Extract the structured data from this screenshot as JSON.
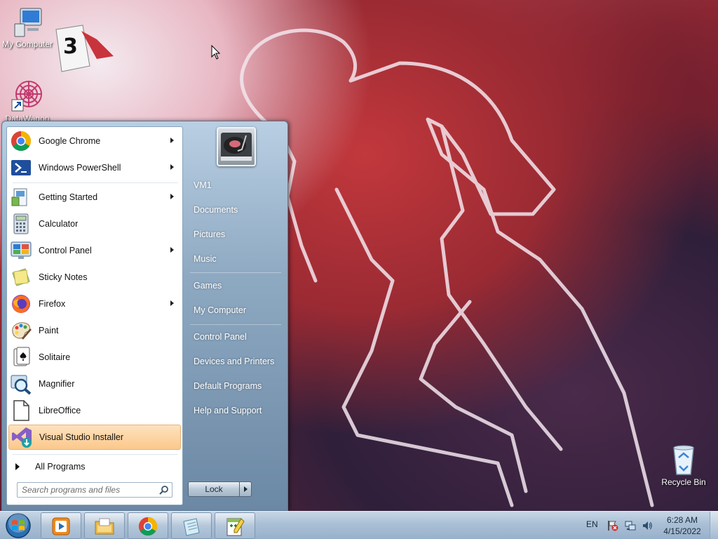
{
  "desktop": {
    "icons": [
      {
        "label": "My Computer"
      },
      {
        "label": "DataWagon"
      },
      {
        "label": "Recycle Bin"
      }
    ]
  },
  "start_menu": {
    "programs": [
      {
        "label": "Google Chrome",
        "icon": "chrome-icon",
        "submenu": true
      },
      {
        "label": "Windows PowerShell",
        "icon": "powershell-icon",
        "submenu": true
      },
      {
        "label": "Getting Started",
        "icon": "getting-started-icon",
        "submenu": true
      },
      {
        "label": "Calculator",
        "icon": "calculator-icon",
        "submenu": false
      },
      {
        "label": "Control Panel",
        "icon": "control-panel-icon",
        "submenu": true
      },
      {
        "label": "Sticky Notes",
        "icon": "sticky-notes-icon",
        "submenu": false
      },
      {
        "label": "Firefox",
        "icon": "firefox-icon",
        "submenu": true
      },
      {
        "label": "Paint",
        "icon": "paint-icon",
        "submenu": false
      },
      {
        "label": "Solitaire",
        "icon": "solitaire-icon",
        "submenu": false
      },
      {
        "label": "Magnifier",
        "icon": "magnifier-icon",
        "submenu": false
      },
      {
        "label": "LibreOffice",
        "icon": "libreoffice-icon",
        "submenu": false
      },
      {
        "label": "Visual Studio Installer",
        "icon": "visual-studio-installer-icon",
        "submenu": false,
        "selected": true
      }
    ],
    "all_programs_label": "All Programs",
    "search_placeholder": "Search programs and files",
    "right_links": [
      "VM1",
      "Documents",
      "Pictures",
      "Music",
      "Games",
      "My Computer",
      "Control Panel",
      "Devices and Printers",
      "Default Programs",
      "Help and Support"
    ],
    "lock_label": "Lock"
  },
  "taskbar": {
    "pinned": [
      "media-player-icon",
      "file-explorer-icon",
      "chrome-icon",
      "notepad-icon",
      "notepad-plus-plus-icon"
    ],
    "language": "EN",
    "time": "6:28 AM",
    "date": "4/15/2022"
  },
  "colors": {
    "selection": "#fbc88c",
    "start_menu_right": "#8ea9c2",
    "taskbar": "#a9bfd5"
  }
}
